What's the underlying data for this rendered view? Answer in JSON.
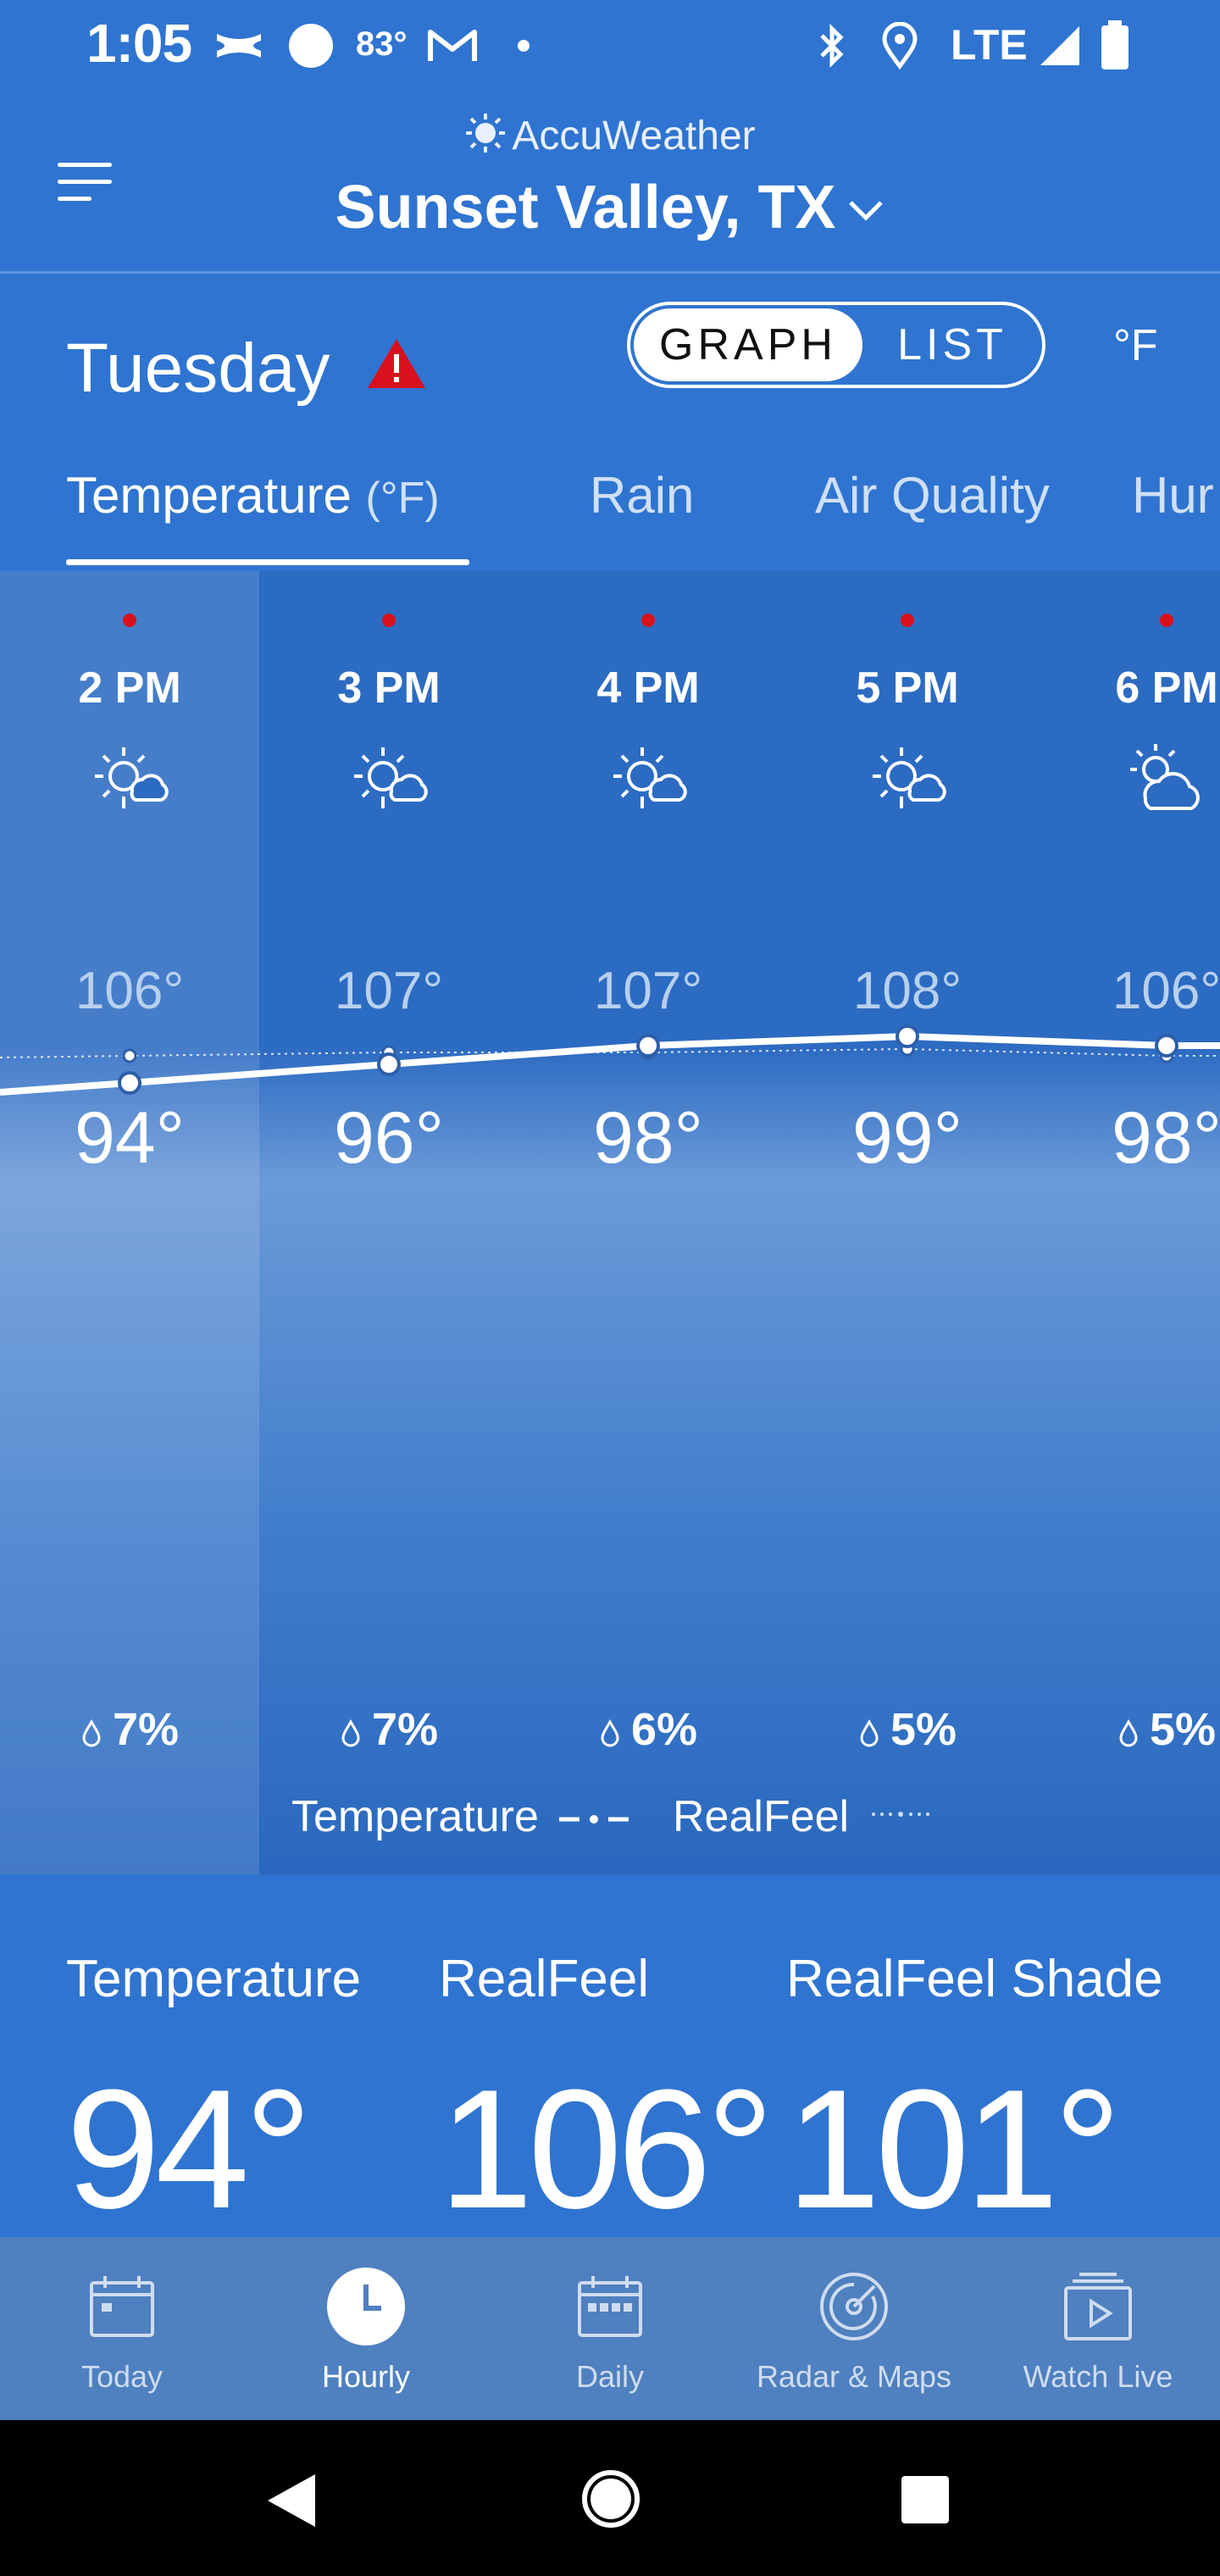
{
  "status_bar": {
    "time": "1:05",
    "temperature": "83°",
    "network": "LTE"
  },
  "header": {
    "brand": "AccuWeather",
    "location": "Sunset Valley, TX"
  },
  "day": {
    "name": "Tuesday"
  },
  "view_toggle": {
    "graph": "GRAPH",
    "list": "LIST",
    "selected": "GRAPH"
  },
  "unit": "°F",
  "tabs": [
    {
      "label": "Temperature",
      "sub": "(°F)",
      "active": true
    },
    {
      "label": "Rain"
    },
    {
      "label": "Air Quality"
    },
    {
      "label": "Hur"
    }
  ],
  "chart_data": {
    "type": "line",
    "x": [
      "2 PM",
      "3 PM",
      "4 PM",
      "5 PM",
      "6 PM"
    ],
    "series": [
      {
        "name": "Temperature",
        "values": [
          94,
          96,
          98,
          99,
          98
        ]
      },
      {
        "name": "RealFeel",
        "values": [
          106,
          107,
          107,
          108,
          106
        ]
      }
    ]
  },
  "hourly": [
    {
      "hour": "2 PM",
      "realfeel": "106°",
      "temp": "94°",
      "precip": "7%",
      "icon": "mostly-sunny-icon"
    },
    {
      "hour": "3 PM",
      "realfeel": "107°",
      "temp": "96°",
      "precip": "7%",
      "icon": "mostly-sunny-icon"
    },
    {
      "hour": "4 PM",
      "realfeel": "107°",
      "temp": "98°",
      "precip": "6%",
      "icon": "mostly-sunny-icon"
    },
    {
      "hour": "5 PM",
      "realfeel": "108°",
      "temp": "99°",
      "precip": "5%",
      "icon": "mostly-sunny-icon"
    },
    {
      "hour": "6 PM",
      "realfeel": "106°",
      "temp": "98°",
      "precip": "5%",
      "icon": "partly-cloudy-icon"
    }
  ],
  "legend": {
    "temperature": "Temperature",
    "realfeel": "RealFeel"
  },
  "details": {
    "temperature_label": "Temperature",
    "temperature_value": "94°",
    "realfeel_label": "RealFeel",
    "realfeel_value": "106°",
    "shade_label": "RealFeel Shade",
    "shade_value": "101°"
  },
  "bottom_nav": [
    {
      "label": "Today",
      "icon": "calendar-today-icon"
    },
    {
      "label": "Hourly",
      "icon": "clock-icon",
      "active": true
    },
    {
      "label": "Daily",
      "icon": "calendar-daily-icon"
    },
    {
      "label": "Radar & Maps",
      "icon": "radar-icon"
    },
    {
      "label": "Watch Live",
      "icon": "watch-live-icon"
    }
  ],
  "colors": {
    "background": "#2f74d0",
    "alert": "#d8111d",
    "nav": "#4f80bf"
  }
}
